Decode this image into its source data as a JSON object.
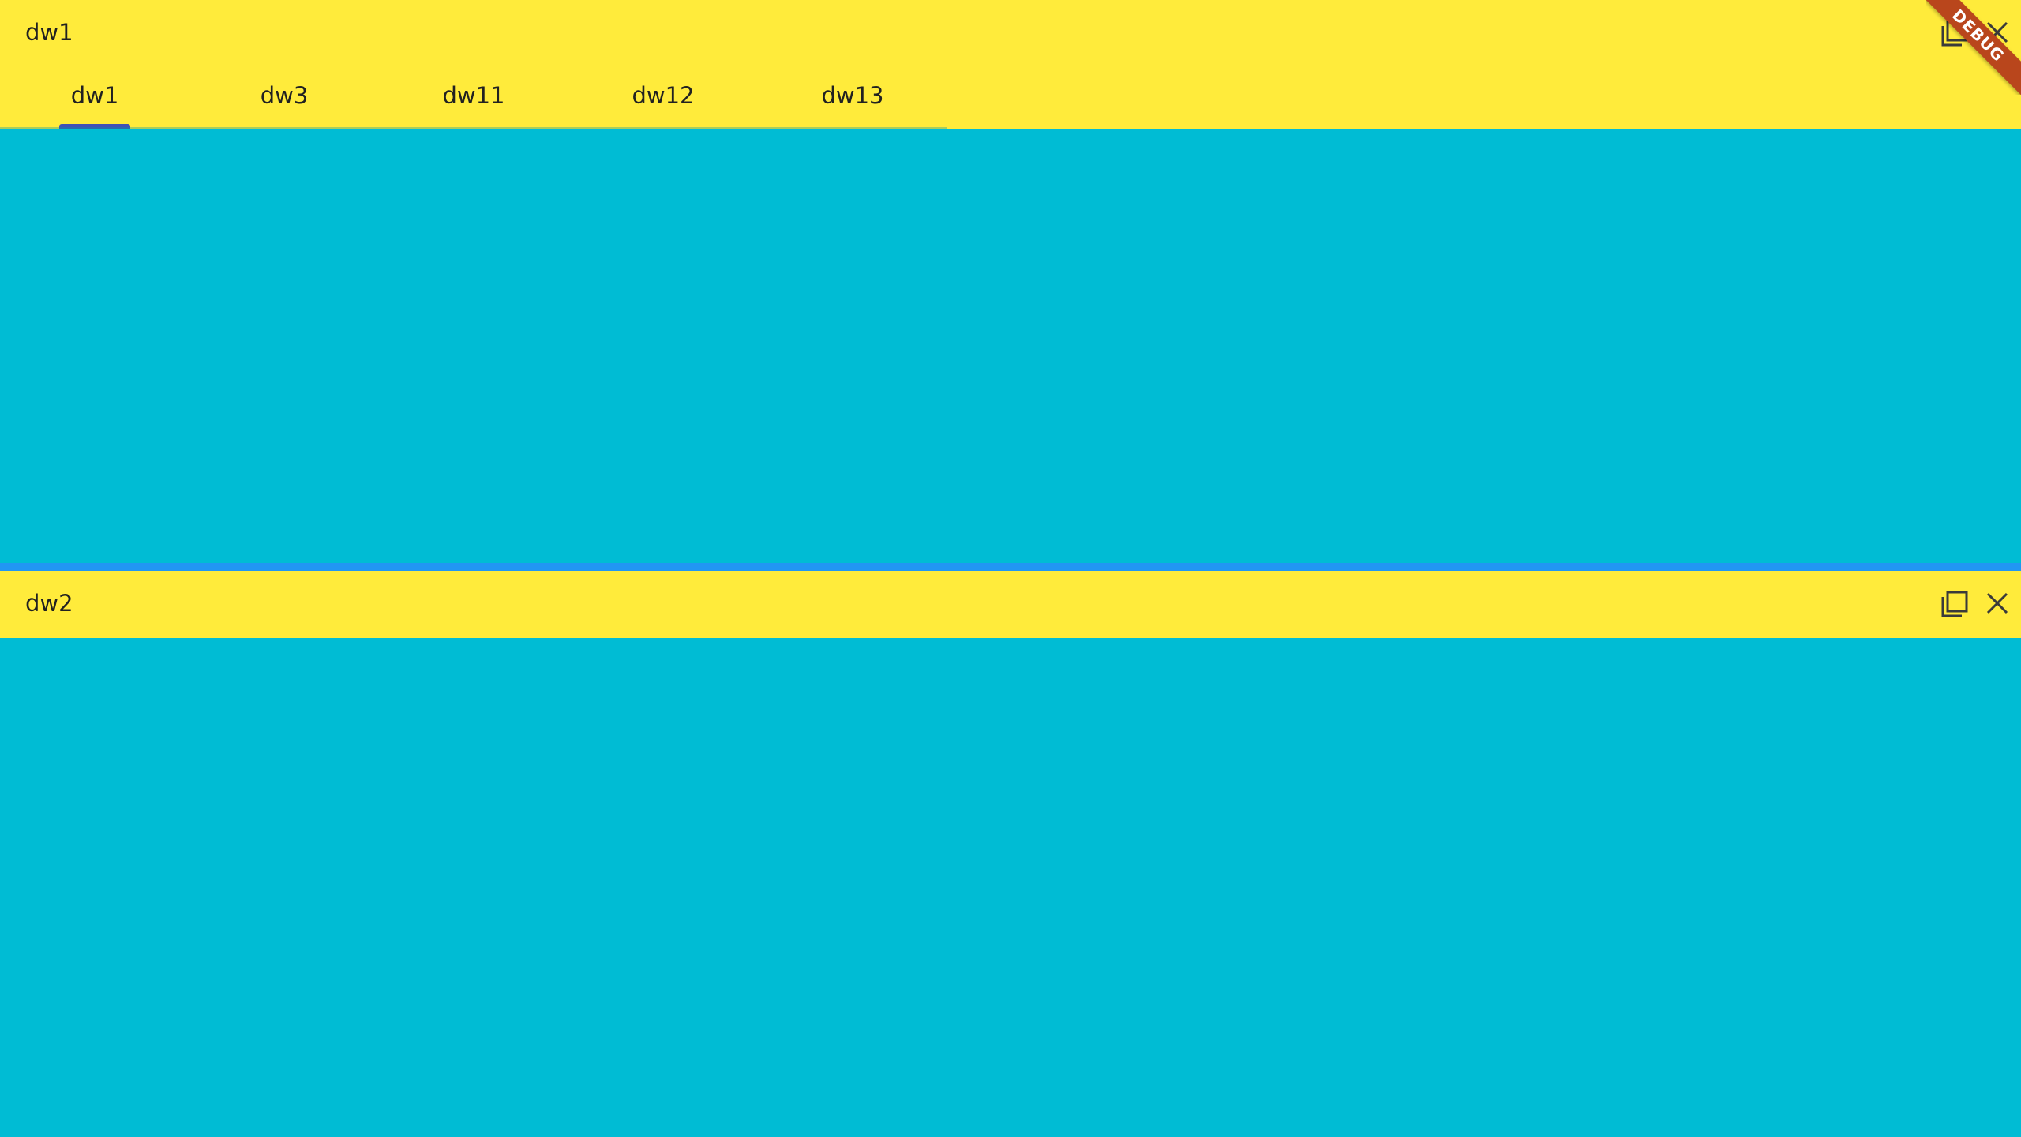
{
  "colors": {
    "header_bg": "#FFEB3B",
    "content_bg": "#00BCD4",
    "divider": "#2196F3",
    "tab_indicator": "#3F51B5",
    "debug_ribbon": "#B9461C"
  },
  "top_pane": {
    "title": "dw1",
    "controls": [
      "maximize-icon",
      "close-icon"
    ],
    "tabs": [
      {
        "label": "dw1",
        "selected": true
      },
      {
        "label": "dw3",
        "selected": false
      },
      {
        "label": "dw11",
        "selected": false
      },
      {
        "label": "dw12",
        "selected": false
      },
      {
        "label": "dw13",
        "selected": false
      }
    ]
  },
  "bottom_pane": {
    "title": "dw2",
    "controls": [
      "maximize-icon",
      "close-icon"
    ]
  },
  "debug_banner": {
    "label": "DEBUG"
  }
}
